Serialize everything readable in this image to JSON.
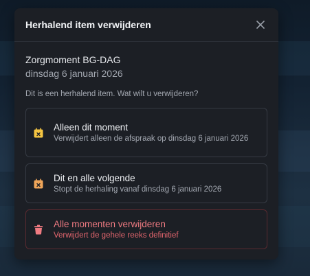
{
  "dialog": {
    "title": "Herhalend item verwijderen",
    "close_icon": "close-icon"
  },
  "item": {
    "title": "Zorgmoment BG-DAG",
    "date": "dinsdag 6 januari 2026"
  },
  "question": "Dit is een herhalend item. Wat wilt u verwijderen?",
  "options": [
    {
      "label": "Alleen dit moment",
      "description": "Verwijdert alleen de afspraak op dinsdag 6 januari 2026",
      "icon": "calendar-x-icon",
      "color": "#f5c542"
    },
    {
      "label": "Dit en alle volgende",
      "description": "Stopt de herhaling vanaf dinsdag 6 januari 2026",
      "icon": "calendar-stop-icon",
      "color": "#f0a65a"
    },
    {
      "label": "Alle momenten verwijderen",
      "description": "Verwijdert de gehele reeks definitief",
      "icon": "trash-icon",
      "color": "#f07b82"
    }
  ]
}
